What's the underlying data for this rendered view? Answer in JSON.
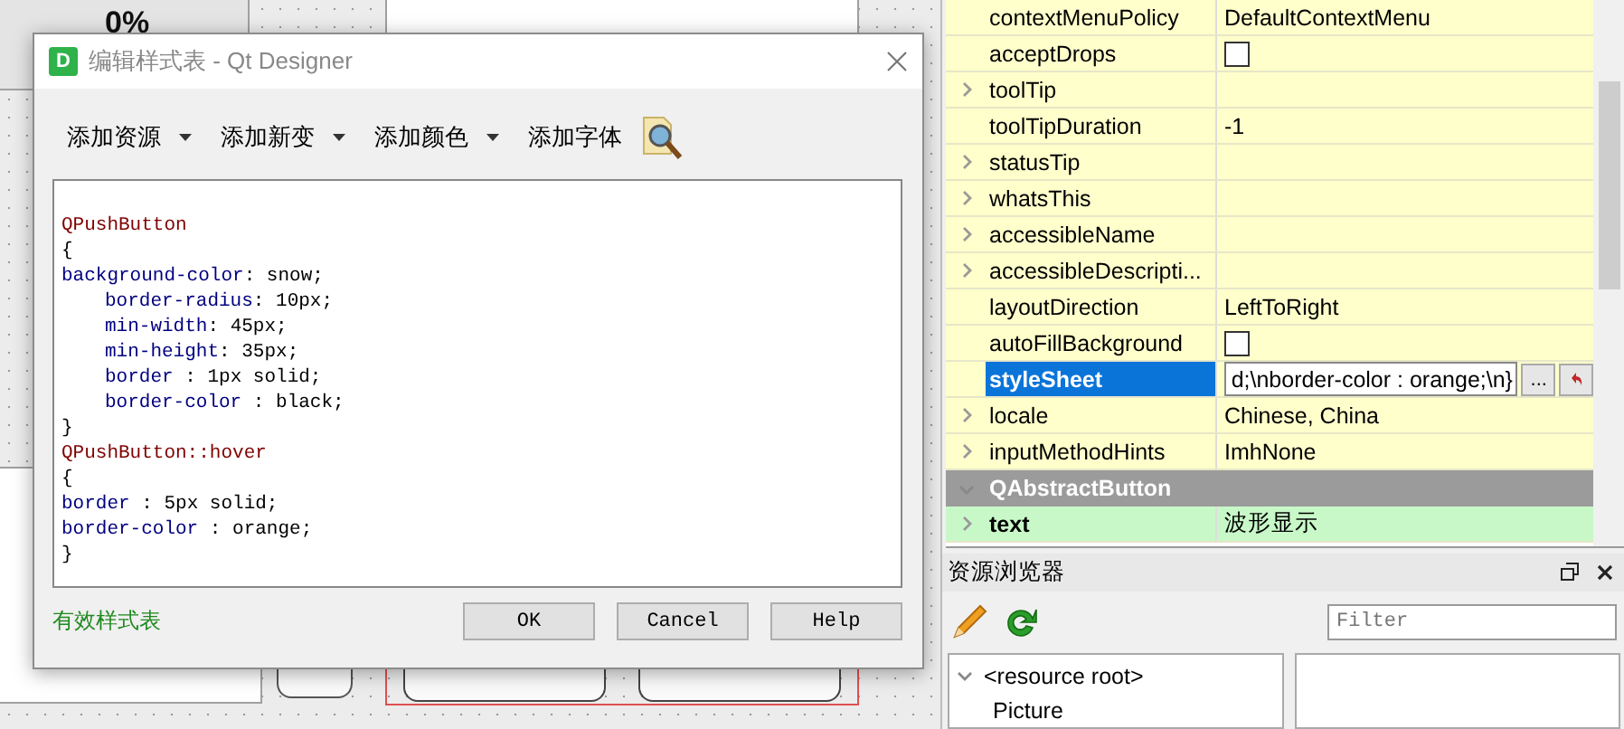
{
  "form_canvas": {
    "progress_label": "0%"
  },
  "dialog": {
    "icon_letter": "D",
    "title": "编辑样式表 - Qt Designer",
    "toolbar": [
      {
        "label": "添加资源",
        "has_menu": true
      },
      {
        "label": "添加新变",
        "has_menu": true
      },
      {
        "label": "添加颜色",
        "has_menu": true
      },
      {
        "label": "添加字体",
        "has_menu": false
      }
    ],
    "code_lines": [
      {
        "kind": "blank"
      },
      {
        "kind": "selector",
        "text": "QPushButton"
      },
      {
        "kind": "brace",
        "text": "{"
      },
      {
        "kind": "declaration",
        "indent": false,
        "property": "background-color",
        "rest": ": snow;"
      },
      {
        "kind": "declaration",
        "indent": true,
        "property": "border-radius",
        "rest": ": 10px;"
      },
      {
        "kind": "declaration",
        "indent": true,
        "property": "min-width",
        "rest": ": 45px;"
      },
      {
        "kind": "declaration",
        "indent": true,
        "property": "min-height",
        "rest": ": 35px;"
      },
      {
        "kind": "declaration",
        "indent": true,
        "property": "border",
        "rest": " : 1px solid;"
      },
      {
        "kind": "declaration",
        "indent": true,
        "property": "border-color",
        "rest": " : black;"
      },
      {
        "kind": "brace",
        "text": "}"
      },
      {
        "kind": "selector",
        "text": "QPushButton::hover"
      },
      {
        "kind": "brace",
        "text": "{"
      },
      {
        "kind": "declaration",
        "indent": false,
        "property": "border",
        "rest": " : 5px solid;"
      },
      {
        "kind": "declaration",
        "indent": false,
        "property": "border-color",
        "rest": " : orange;"
      },
      {
        "kind": "brace",
        "text": "}"
      }
    ],
    "status": "有效样式表",
    "buttons": [
      "OK",
      "Cancel",
      "Help"
    ]
  },
  "property_editor": {
    "sections": [
      {
        "color": "#ffffcc",
        "rows": [
          {
            "name": "contextMenuPolicy",
            "expandable": false,
            "selected": false,
            "kind": "text",
            "value": "DefaultContextMenu"
          },
          {
            "name": "acceptDrops",
            "expandable": false,
            "selected": false,
            "kind": "checkbox",
            "checked": false
          },
          {
            "name": "toolTip",
            "expandable": true,
            "selected": false,
            "kind": "text",
            "value": ""
          },
          {
            "name": "toolTipDuration",
            "expandable": false,
            "selected": false,
            "kind": "text",
            "value": "-1"
          },
          {
            "name": "statusTip",
            "expandable": true,
            "selected": false,
            "kind": "text",
            "value": ""
          },
          {
            "name": "whatsThis",
            "expandable": true,
            "selected": false,
            "kind": "text",
            "value": ""
          },
          {
            "name": "accessibleName",
            "expandable": true,
            "selected": false,
            "kind": "text",
            "value": ""
          },
          {
            "name": "accessibleDescripti...",
            "expandable": true,
            "selected": false,
            "kind": "text",
            "value": ""
          },
          {
            "name": "layoutDirection",
            "expandable": false,
            "selected": false,
            "kind": "text",
            "value": "LeftToRight"
          },
          {
            "name": "autoFillBackground",
            "expandable": false,
            "selected": false,
            "kind": "checkbox",
            "checked": false
          },
          {
            "name": "styleSheet",
            "expandable": false,
            "selected": true,
            "kind": "edit",
            "value": "d;\\nborder-color : orange;\\n}",
            "button": "..."
          },
          {
            "name": "locale",
            "expandable": true,
            "selected": false,
            "kind": "text",
            "value": "Chinese, China"
          },
          {
            "name": "inputMethodHints",
            "expandable": true,
            "selected": false,
            "kind": "text",
            "value": "ImhNone"
          }
        ]
      },
      {
        "color": "#c8f8c8",
        "title": "QAbstractButton",
        "expanded": true,
        "rows": [
          {
            "name": "text",
            "expandable": true,
            "selected": false,
            "kind": "text",
            "value": "波形显示",
            "modified": true
          }
        ]
      }
    ]
  },
  "resource_browser": {
    "title": "资源浏览器",
    "filter": {
      "placeholder": "Filter"
    },
    "tree": [
      {
        "label": "<resource root>",
        "expanded": true,
        "children": [
          {
            "label": "Picture"
          }
        ]
      }
    ]
  }
}
